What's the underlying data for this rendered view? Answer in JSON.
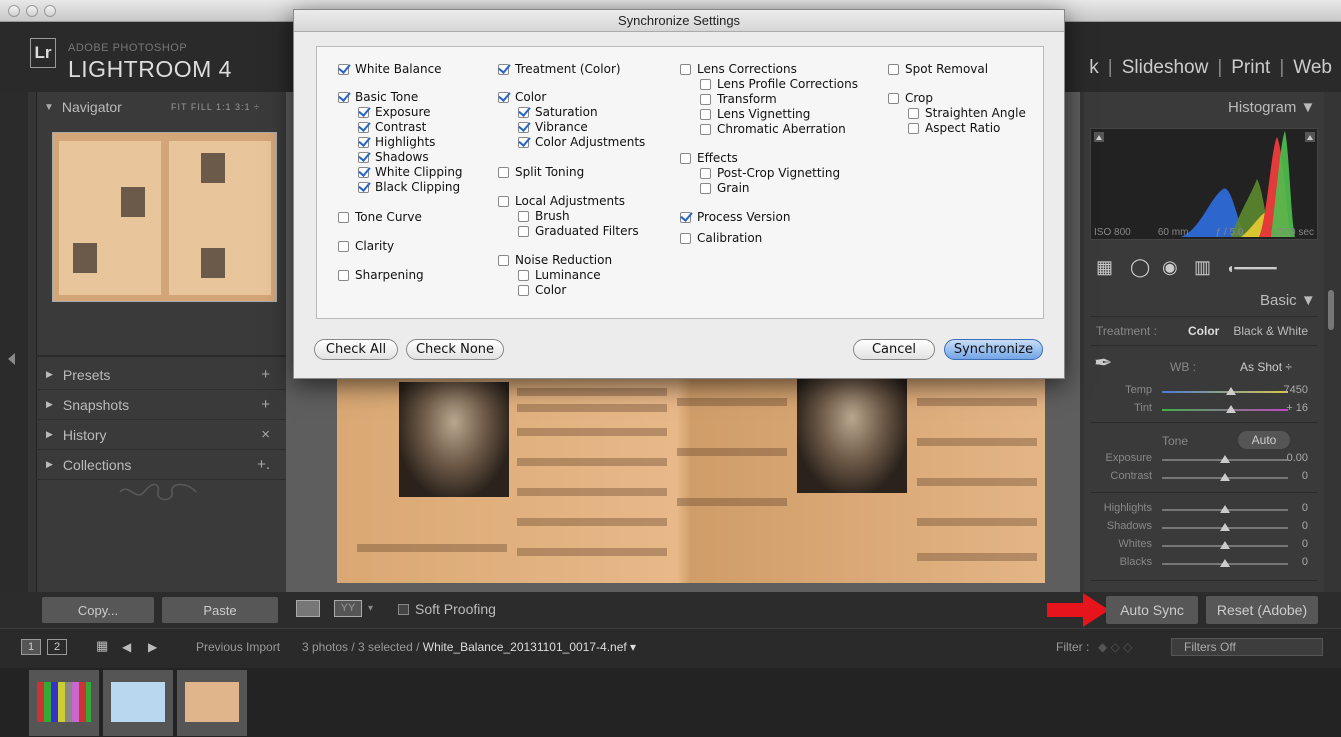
{
  "app": {
    "brand_small": "ADOBE PHOTOSHOP",
    "brand_big": "LIGHTROOM 4",
    "badge": "Lr",
    "modules": [
      "k",
      "Slideshow",
      "Print",
      "Web"
    ],
    "module_sep": "|"
  },
  "left_panel": {
    "navigator_label": "Navigator",
    "zoom_options": "FIT  FILL  1:1  3:1 ÷",
    "items": [
      {
        "label": "Presets",
        "action": "+"
      },
      {
        "label": "Snapshots",
        "action": "+"
      },
      {
        "label": "History",
        "action": "×"
      },
      {
        "label": "Collections",
        "action": "+."
      }
    ],
    "copy_label": "Copy...",
    "paste_label": "Paste"
  },
  "center_toolbar": {
    "view_label": "YY",
    "soft_proofing_label": "Soft Proofing"
  },
  "right_panel": {
    "histogram_label": "Histogram ▼",
    "hist_info": {
      "iso": "ISO 800",
      "focal": "60 mm",
      "aperture": "ƒ / 5.0",
      "shutter": "1/500 sec"
    },
    "basic_label": "Basic ▼",
    "treatment_label": "Treatment :",
    "treatment_color": "Color",
    "treatment_bw": "Black & White",
    "wb_label": "WB :",
    "wb_value": "As Shot ÷",
    "tone_label": "Tone",
    "auto_label": "Auto",
    "sliders": [
      {
        "name": "Temp",
        "value": "7450",
        "pos": 0.55
      },
      {
        "name": "Tint",
        "value": "+ 16",
        "pos": 0.55
      },
      {
        "name": "Exposure",
        "value": "0.00",
        "pos": 0.5
      },
      {
        "name": "Contrast",
        "value": "0",
        "pos": 0.5
      },
      {
        "name": "Highlights",
        "value": "0",
        "pos": 0.5
      },
      {
        "name": "Shadows",
        "value": "0",
        "pos": 0.5
      },
      {
        "name": "Whites",
        "value": "0",
        "pos": 0.5
      },
      {
        "name": "Blacks",
        "value": "0",
        "pos": 0.5
      }
    ],
    "auto_sync_label": "Auto Sync",
    "reset_label": "Reset (Adobe)"
  },
  "filmstrip_bar": {
    "page1": "1",
    "page2": "2",
    "source": "Previous Import",
    "selection_prefix": "3 photos / 3 selected /",
    "filename": "White_Balance_20131101_0017-4.nef ▾",
    "filter_label": "Filter :",
    "filters_value": "Filters Off"
  },
  "dialog": {
    "title": "Synchronize Settings",
    "col1": [
      {
        "label": "White Balance",
        "checked": true,
        "indent": 0
      },
      {
        "label": "Basic Tone",
        "checked": true,
        "indent": 0
      },
      {
        "label": "Exposure",
        "checked": true,
        "indent": 1
      },
      {
        "label": "Contrast",
        "checked": true,
        "indent": 1
      },
      {
        "label": "Highlights",
        "checked": true,
        "indent": 1
      },
      {
        "label": "Shadows",
        "checked": true,
        "indent": 1
      },
      {
        "label": "White Clipping",
        "checked": true,
        "indent": 1
      },
      {
        "label": "Black Clipping",
        "checked": true,
        "indent": 1
      },
      {
        "label": "Tone Curve",
        "checked": false,
        "indent": 0
      },
      {
        "label": "Clarity",
        "checked": false,
        "indent": 0
      },
      {
        "label": "Sharpening",
        "checked": false,
        "indent": 0
      }
    ],
    "col2": [
      {
        "label": "Treatment (Color)",
        "checked": true,
        "indent": 0
      },
      {
        "label": "Color",
        "checked": true,
        "indent": 0
      },
      {
        "label": "Saturation",
        "checked": true,
        "indent": 1
      },
      {
        "label": "Vibrance",
        "checked": true,
        "indent": 1
      },
      {
        "label": "Color Adjustments",
        "checked": true,
        "indent": 1
      },
      {
        "label": "Split Toning",
        "checked": false,
        "indent": 0
      },
      {
        "label": "Local Adjustments",
        "checked": false,
        "indent": 0
      },
      {
        "label": "Brush",
        "checked": false,
        "indent": 1
      },
      {
        "label": "Graduated Filters",
        "checked": false,
        "indent": 1
      },
      {
        "label": "Noise Reduction",
        "checked": false,
        "indent": 0
      },
      {
        "label": "Luminance",
        "checked": false,
        "indent": 1
      },
      {
        "label": "Color",
        "checked": false,
        "indent": 1
      }
    ],
    "col3": [
      {
        "label": "Lens Corrections",
        "checked": false,
        "indent": 0
      },
      {
        "label": "Lens Profile Corrections",
        "checked": false,
        "indent": 1
      },
      {
        "label": "Transform",
        "checked": false,
        "indent": 1
      },
      {
        "label": "Lens Vignetting",
        "checked": false,
        "indent": 1
      },
      {
        "label": "Chromatic Aberration",
        "checked": false,
        "indent": 1
      },
      {
        "label": "Effects",
        "checked": false,
        "indent": 0
      },
      {
        "label": "Post-Crop Vignetting",
        "checked": false,
        "indent": 1
      },
      {
        "label": "Grain",
        "checked": false,
        "indent": 1
      },
      {
        "label": "Process Version",
        "checked": true,
        "indent": 0
      },
      {
        "label": "Calibration",
        "checked": false,
        "indent": 0
      }
    ],
    "col4": [
      {
        "label": "Spot Removal",
        "checked": false,
        "indent": 0
      },
      {
        "label": "Crop",
        "checked": false,
        "indent": 0
      },
      {
        "label": "Straighten Angle",
        "checked": false,
        "indent": 1
      },
      {
        "label": "Aspect Ratio",
        "checked": false,
        "indent": 1
      }
    ],
    "check_all_label": "Check All",
    "check_none_label": "Check None",
    "cancel_label": "Cancel",
    "synchronize_label": "Synchronize"
  },
  "colors": {
    "accent_blue": "#2a66c8",
    "arrow_red": "#e8141b"
  }
}
